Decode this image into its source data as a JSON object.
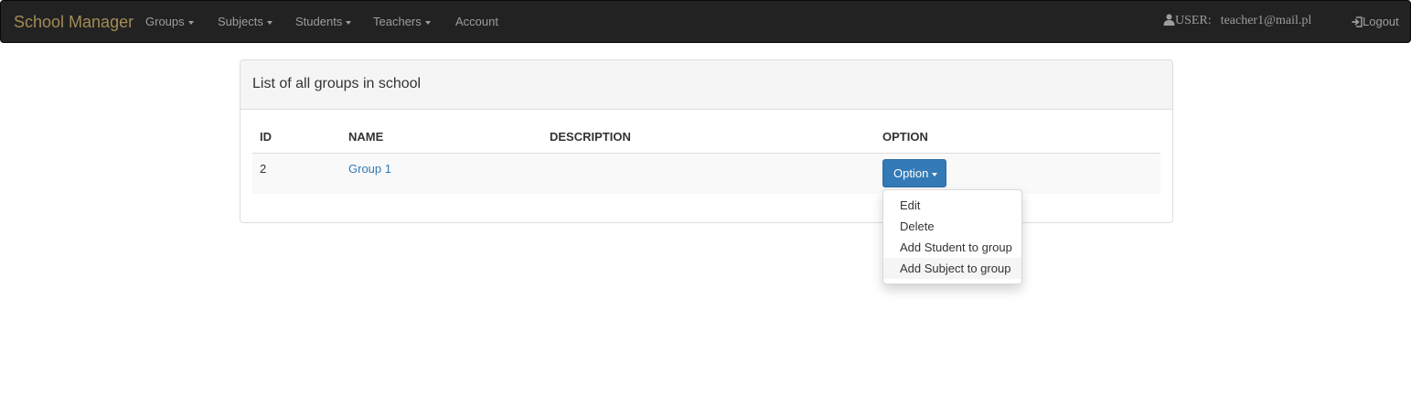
{
  "navbar": {
    "brand": "School Manager",
    "items": [
      {
        "label": "Groups",
        "dropdown": true
      },
      {
        "label": "Subjects",
        "dropdown": true
      },
      {
        "label": "Students",
        "dropdown": true
      },
      {
        "label": "Teachers",
        "dropdown": true
      },
      {
        "label": "Account",
        "dropdown": false
      }
    ],
    "user_label": "USER:",
    "user_email": "teacher1@mail.pl",
    "logout_label": "Logout",
    "user_icon": "user-icon",
    "logout_icon": "logout-icon"
  },
  "panel": {
    "title": "List of all groups in school"
  },
  "table": {
    "headers": [
      "ID",
      "NAME",
      "DESCRIPTION",
      "OPTION"
    ],
    "rows": [
      {
        "id": "2",
        "name": "Group 1",
        "description": ""
      }
    ]
  },
  "option_button": {
    "label": "Option"
  },
  "dropdown_menu": {
    "items": [
      "Edit",
      "Delete",
      "Add Student to group",
      "Add Subject to group"
    ],
    "hovered_index": 3
  },
  "colors": {
    "navbar_bg": "#222222",
    "brand": "#a58b55",
    "link": "#337ab7",
    "primary_button": "#337ab7"
  }
}
